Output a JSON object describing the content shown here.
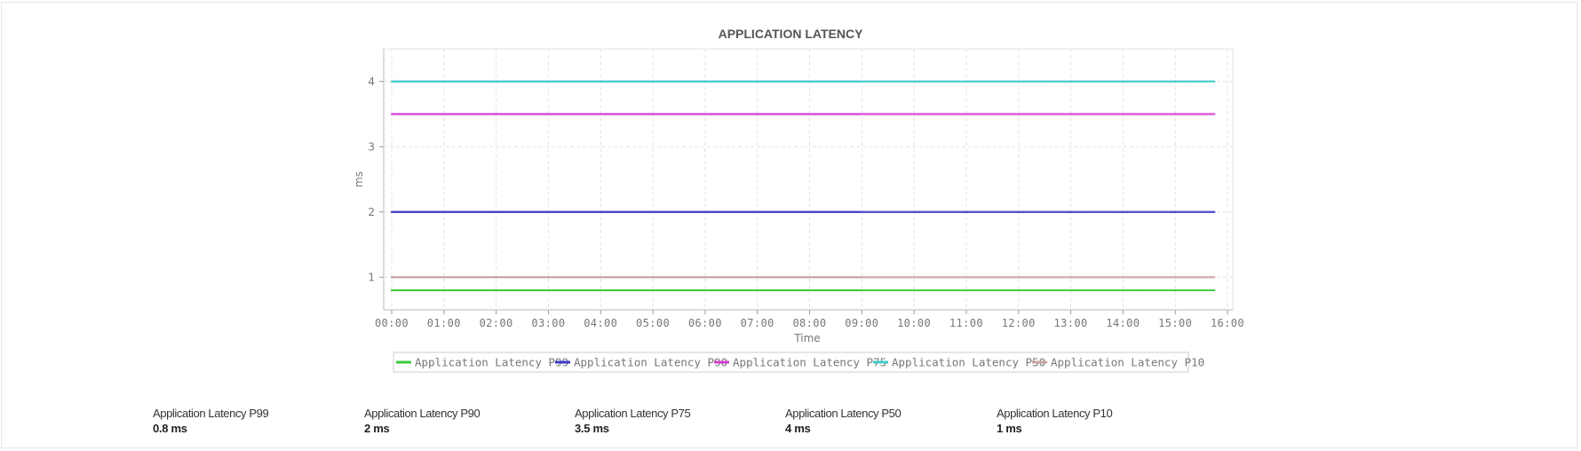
{
  "chart_data": {
    "type": "line",
    "title": "APPLICATION LATENCY",
    "xlabel": "Time",
    "ylabel": "ms",
    "x_ticks": [
      "00:00",
      "01:00",
      "02:00",
      "03:00",
      "04:00",
      "05:00",
      "06:00",
      "07:00",
      "08:00",
      "09:00",
      "10:00",
      "11:00",
      "12:00",
      "13:00",
      "14:00",
      "15:00",
      "16:00"
    ],
    "y_ticks": [
      1,
      2,
      3,
      4
    ],
    "xlim": [
      "00:00",
      "16:00"
    ],
    "ylim": [
      0.5,
      4.5
    ],
    "x_start": "00:00",
    "x_end": "15:45",
    "grid": true,
    "legend_position": "bottom",
    "series": [
      {
        "name": "Application Latency P99",
        "color": "#3ec93e",
        "values": [
          0.8,
          0.8
        ]
      },
      {
        "name": "Application Latency P90",
        "color": "#3b3bc9",
        "values": [
          2,
          2
        ]
      },
      {
        "name": "Application Latency P75",
        "color": "#d43fd4",
        "values": [
          3.5,
          3.5
        ]
      },
      {
        "name": "Application Latency P50",
        "color": "#3fc9c9",
        "values": [
          4,
          4
        ]
      },
      {
        "name": "Application Latency P10",
        "color": "#c9a3a3",
        "values": [
          1,
          1
        ]
      }
    ]
  },
  "summary": [
    {
      "label": "Application Latency P99",
      "value": "0.8 ms"
    },
    {
      "label": "Application Latency P90",
      "value": "2 ms"
    },
    {
      "label": "Application Latency P75",
      "value": "3.5 ms"
    },
    {
      "label": "Application Latency P50",
      "value": "4 ms"
    },
    {
      "label": "Application Latency P10",
      "value": "1 ms"
    }
  ]
}
